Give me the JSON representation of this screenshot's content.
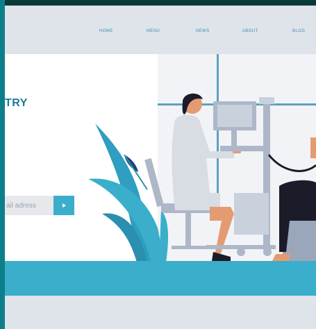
{
  "nav": {
    "items": [
      {
        "label": "HOME"
      },
      {
        "label": "MENU"
      },
      {
        "label": "NEWS"
      },
      {
        "label": "ABOUT"
      },
      {
        "label": "BLOG"
      }
    ]
  },
  "hero": {
    "title": "TRY",
    "email_placeholder": "ail adress"
  },
  "colors": {
    "accent": "#3aaecb",
    "title": "#1f7a96",
    "nav_bg": "#dfe3ea",
    "frame": "#0d7f8a"
  },
  "icons": {
    "submit": "play-arrow-icon"
  }
}
